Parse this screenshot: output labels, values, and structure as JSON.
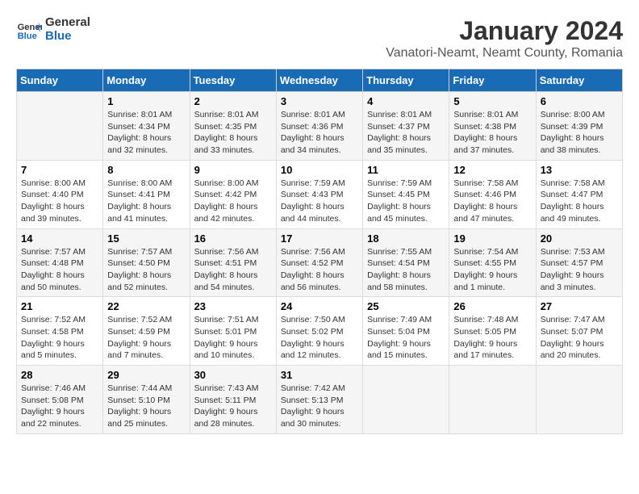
{
  "logo": {
    "line1": "General",
    "line2": "Blue"
  },
  "title": "January 2024",
  "subtitle": "Vanatori-Neamt, Neamt County, Romania",
  "days_of_week": [
    "Sunday",
    "Monday",
    "Tuesday",
    "Wednesday",
    "Thursday",
    "Friday",
    "Saturday"
  ],
  "weeks": [
    [
      {
        "day": "",
        "sunrise": "",
        "sunset": "",
        "daylight": ""
      },
      {
        "day": "1",
        "sunrise": "Sunrise: 8:01 AM",
        "sunset": "Sunset: 4:34 PM",
        "daylight": "Daylight: 8 hours and 32 minutes."
      },
      {
        "day": "2",
        "sunrise": "Sunrise: 8:01 AM",
        "sunset": "Sunset: 4:35 PM",
        "daylight": "Daylight: 8 hours and 33 minutes."
      },
      {
        "day": "3",
        "sunrise": "Sunrise: 8:01 AM",
        "sunset": "Sunset: 4:36 PM",
        "daylight": "Daylight: 8 hours and 34 minutes."
      },
      {
        "day": "4",
        "sunrise": "Sunrise: 8:01 AM",
        "sunset": "Sunset: 4:37 PM",
        "daylight": "Daylight: 8 hours and 35 minutes."
      },
      {
        "day": "5",
        "sunrise": "Sunrise: 8:01 AM",
        "sunset": "Sunset: 4:38 PM",
        "daylight": "Daylight: 8 hours and 37 minutes."
      },
      {
        "day": "6",
        "sunrise": "Sunrise: 8:00 AM",
        "sunset": "Sunset: 4:39 PM",
        "daylight": "Daylight: 8 hours and 38 minutes."
      }
    ],
    [
      {
        "day": "7",
        "sunrise": "Sunrise: 8:00 AM",
        "sunset": "Sunset: 4:40 PM",
        "daylight": "Daylight: 8 hours and 39 minutes."
      },
      {
        "day": "8",
        "sunrise": "Sunrise: 8:00 AM",
        "sunset": "Sunset: 4:41 PM",
        "daylight": "Daylight: 8 hours and 41 minutes."
      },
      {
        "day": "9",
        "sunrise": "Sunrise: 8:00 AM",
        "sunset": "Sunset: 4:42 PM",
        "daylight": "Daylight: 8 hours and 42 minutes."
      },
      {
        "day": "10",
        "sunrise": "Sunrise: 7:59 AM",
        "sunset": "Sunset: 4:43 PM",
        "daylight": "Daylight: 8 hours and 44 minutes."
      },
      {
        "day": "11",
        "sunrise": "Sunrise: 7:59 AM",
        "sunset": "Sunset: 4:45 PM",
        "daylight": "Daylight: 8 hours and 45 minutes."
      },
      {
        "day": "12",
        "sunrise": "Sunrise: 7:58 AM",
        "sunset": "Sunset: 4:46 PM",
        "daylight": "Daylight: 8 hours and 47 minutes."
      },
      {
        "day": "13",
        "sunrise": "Sunrise: 7:58 AM",
        "sunset": "Sunset: 4:47 PM",
        "daylight": "Daylight: 8 hours and 49 minutes."
      }
    ],
    [
      {
        "day": "14",
        "sunrise": "Sunrise: 7:57 AM",
        "sunset": "Sunset: 4:48 PM",
        "daylight": "Daylight: 8 hours and 50 minutes."
      },
      {
        "day": "15",
        "sunrise": "Sunrise: 7:57 AM",
        "sunset": "Sunset: 4:50 PM",
        "daylight": "Daylight: 8 hours and 52 minutes."
      },
      {
        "day": "16",
        "sunrise": "Sunrise: 7:56 AM",
        "sunset": "Sunset: 4:51 PM",
        "daylight": "Daylight: 8 hours and 54 minutes."
      },
      {
        "day": "17",
        "sunrise": "Sunrise: 7:56 AM",
        "sunset": "Sunset: 4:52 PM",
        "daylight": "Daylight: 8 hours and 56 minutes."
      },
      {
        "day": "18",
        "sunrise": "Sunrise: 7:55 AM",
        "sunset": "Sunset: 4:54 PM",
        "daylight": "Daylight: 8 hours and 58 minutes."
      },
      {
        "day": "19",
        "sunrise": "Sunrise: 7:54 AM",
        "sunset": "Sunset: 4:55 PM",
        "daylight": "Daylight: 9 hours and 1 minute."
      },
      {
        "day": "20",
        "sunrise": "Sunrise: 7:53 AM",
        "sunset": "Sunset: 4:57 PM",
        "daylight": "Daylight: 9 hours and 3 minutes."
      }
    ],
    [
      {
        "day": "21",
        "sunrise": "Sunrise: 7:52 AM",
        "sunset": "Sunset: 4:58 PM",
        "daylight": "Daylight: 9 hours and 5 minutes."
      },
      {
        "day": "22",
        "sunrise": "Sunrise: 7:52 AM",
        "sunset": "Sunset: 4:59 PM",
        "daylight": "Daylight: 9 hours and 7 minutes."
      },
      {
        "day": "23",
        "sunrise": "Sunrise: 7:51 AM",
        "sunset": "Sunset: 5:01 PM",
        "daylight": "Daylight: 9 hours and 10 minutes."
      },
      {
        "day": "24",
        "sunrise": "Sunrise: 7:50 AM",
        "sunset": "Sunset: 5:02 PM",
        "daylight": "Daylight: 9 hours and 12 minutes."
      },
      {
        "day": "25",
        "sunrise": "Sunrise: 7:49 AM",
        "sunset": "Sunset: 5:04 PM",
        "daylight": "Daylight: 9 hours and 15 minutes."
      },
      {
        "day": "26",
        "sunrise": "Sunrise: 7:48 AM",
        "sunset": "Sunset: 5:05 PM",
        "daylight": "Daylight: 9 hours and 17 minutes."
      },
      {
        "day": "27",
        "sunrise": "Sunrise: 7:47 AM",
        "sunset": "Sunset: 5:07 PM",
        "daylight": "Daylight: 9 hours and 20 minutes."
      }
    ],
    [
      {
        "day": "28",
        "sunrise": "Sunrise: 7:46 AM",
        "sunset": "Sunset: 5:08 PM",
        "daylight": "Daylight: 9 hours and 22 minutes."
      },
      {
        "day": "29",
        "sunrise": "Sunrise: 7:44 AM",
        "sunset": "Sunset: 5:10 PM",
        "daylight": "Daylight: 9 hours and 25 minutes."
      },
      {
        "day": "30",
        "sunrise": "Sunrise: 7:43 AM",
        "sunset": "Sunset: 5:11 PM",
        "daylight": "Daylight: 9 hours and 28 minutes."
      },
      {
        "day": "31",
        "sunrise": "Sunrise: 7:42 AM",
        "sunset": "Sunset: 5:13 PM",
        "daylight": "Daylight: 9 hours and 30 minutes."
      },
      {
        "day": "",
        "sunrise": "",
        "sunset": "",
        "daylight": ""
      },
      {
        "day": "",
        "sunrise": "",
        "sunset": "",
        "daylight": ""
      },
      {
        "day": "",
        "sunrise": "",
        "sunset": "",
        "daylight": ""
      }
    ]
  ]
}
